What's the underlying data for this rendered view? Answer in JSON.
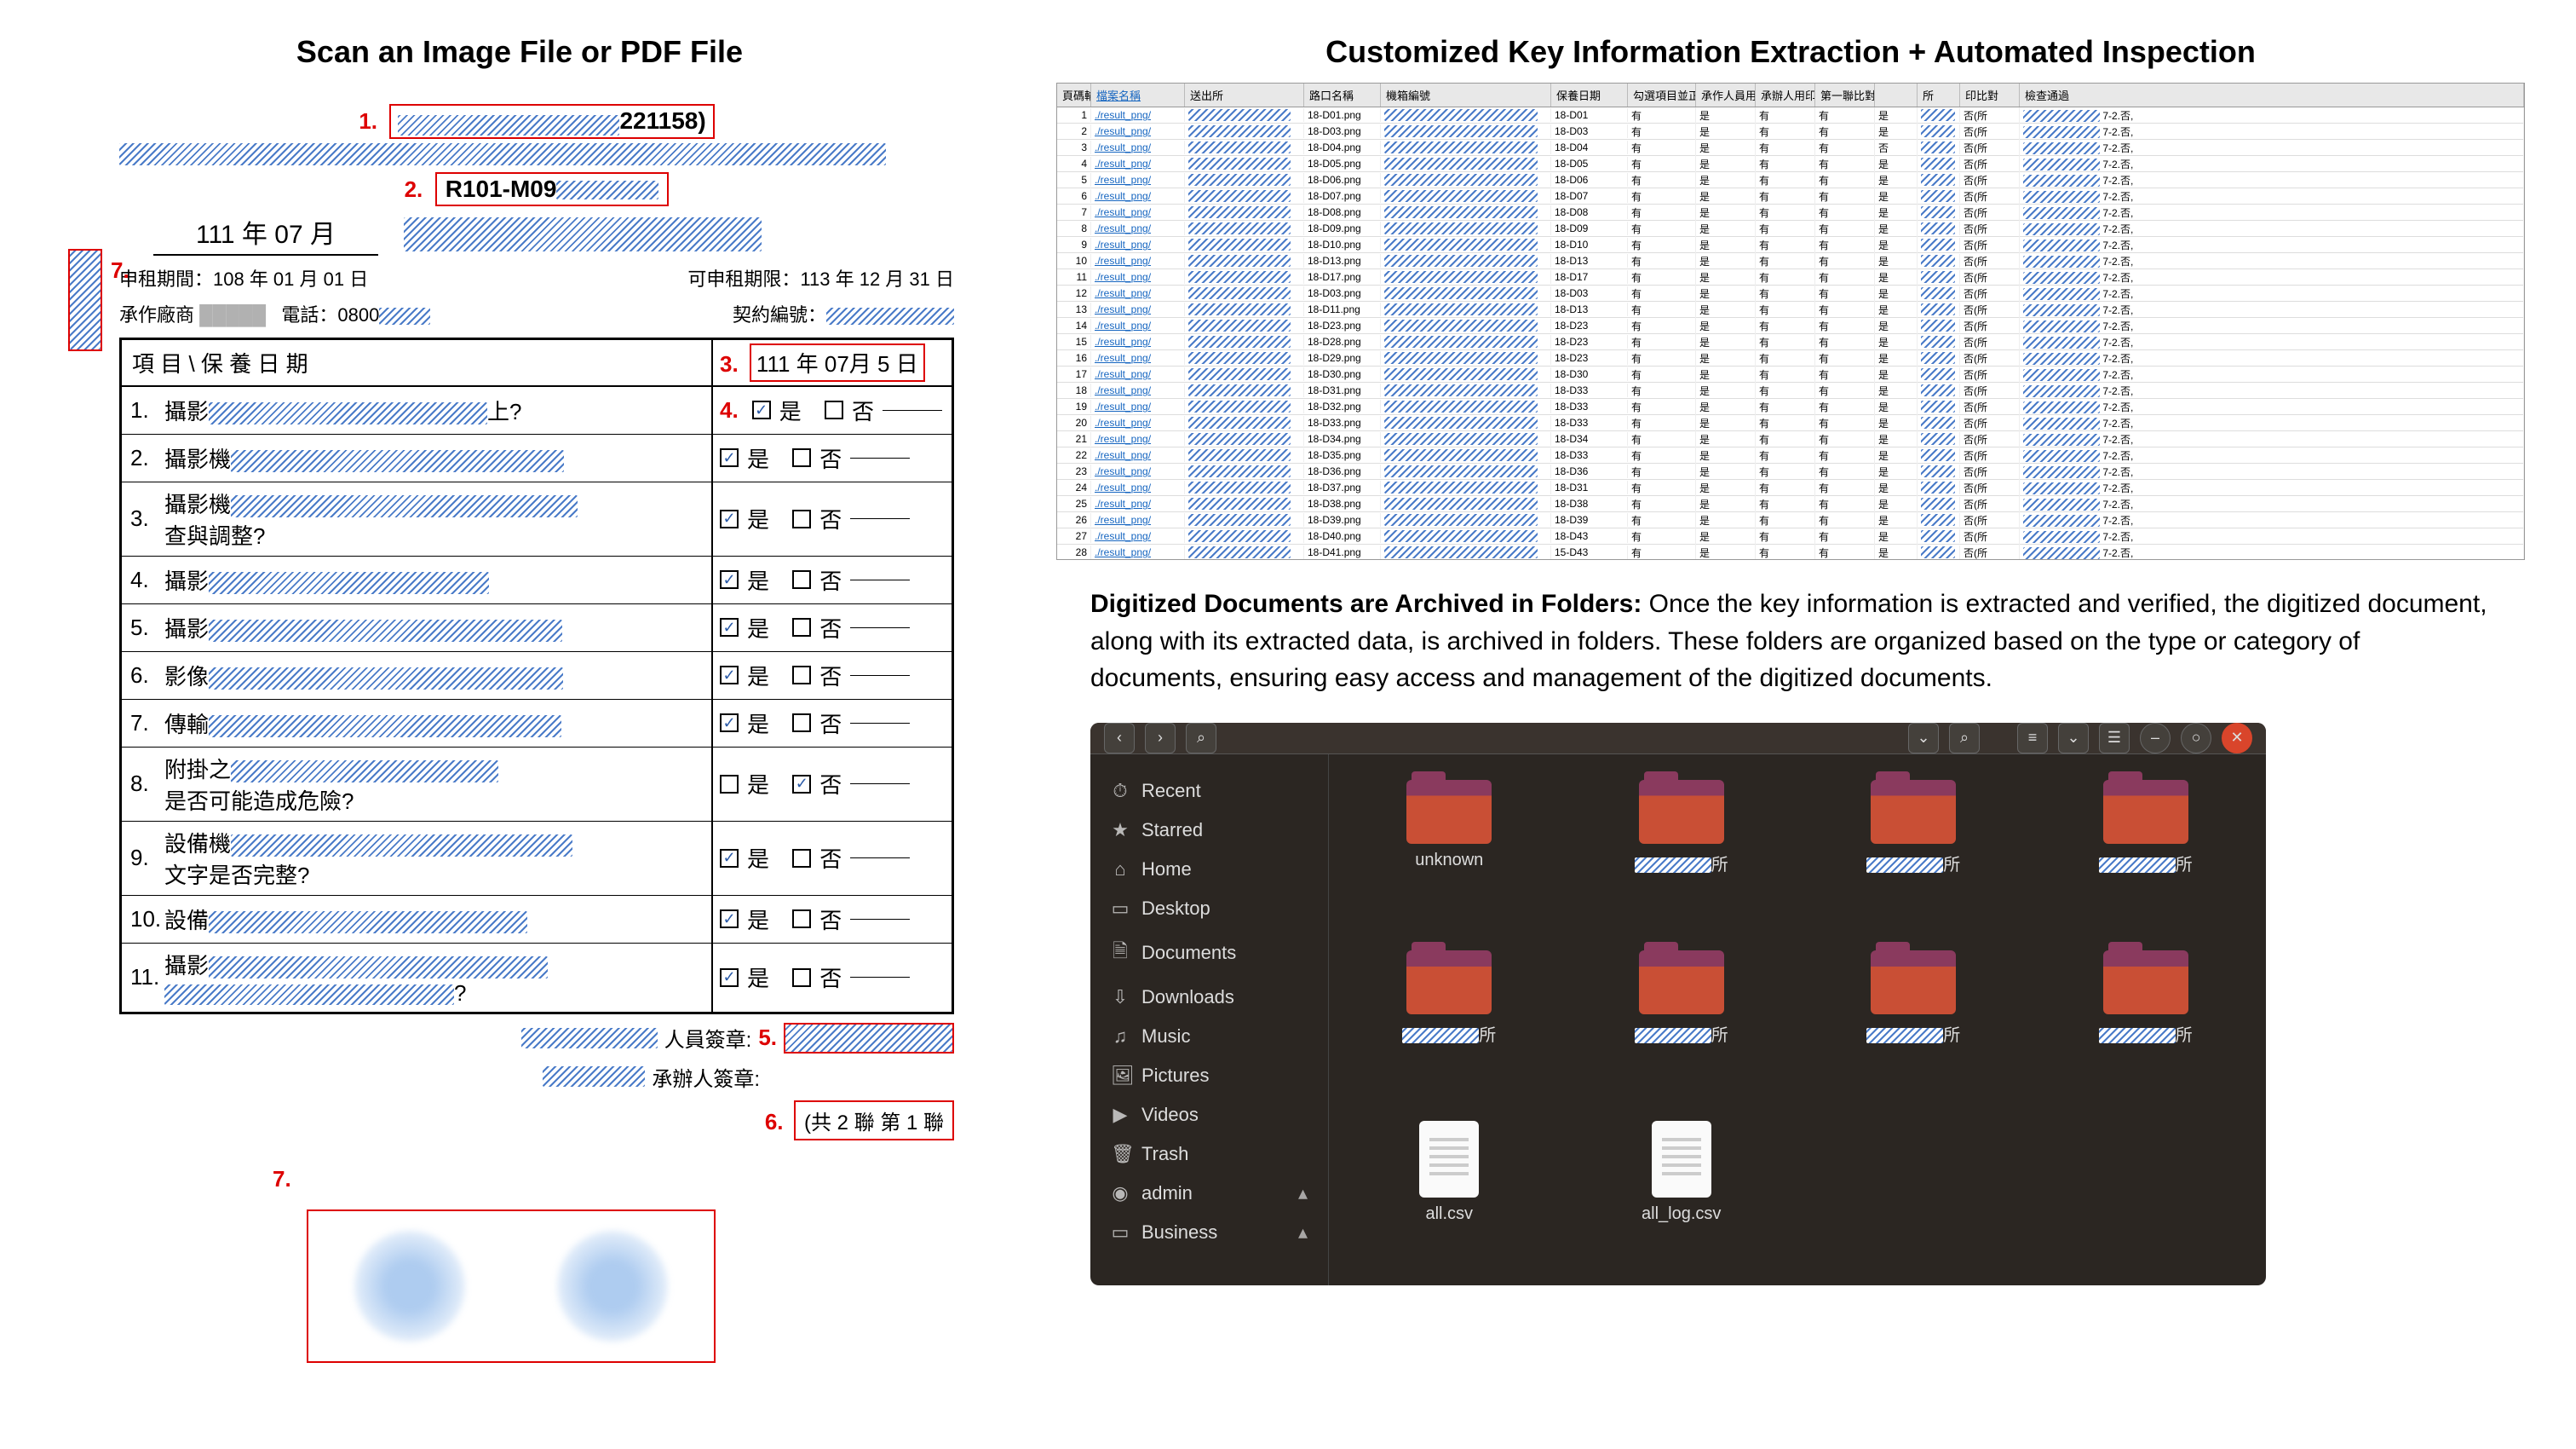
{
  "left": {
    "title": "Scan an Image File or PDF File",
    "markers": {
      "m1": "1.",
      "m2": "2.",
      "m3": "3.",
      "m4": "4.",
      "m5": "5.",
      "m6": "6.",
      "m7": "7.",
      "m7b": "7."
    },
    "doc_id_suffix": "221158)",
    "code": "R101-M09",
    "date_year_month": "111 年 07 月",
    "meta_left": "申租期間：108 年 01 月 01 日",
    "meta_right": "可申租期限：113 年 12 月 31 日",
    "meta_vendor": "承作廠商",
    "meta_tel": "電話：0800",
    "meta_contract": "契約編號：",
    "table_header_left": "項 目 \\ 保 養 日 期",
    "table_header_right": "111 年 07月 5 日",
    "questions": [
      {
        "n": "1.",
        "prefix": "攝影",
        "suffix": "上?",
        "yes": true,
        "no": false
      },
      {
        "n": "2.",
        "prefix": "攝影機",
        "suffix": "",
        "yes": true,
        "no": false
      },
      {
        "n": "3.",
        "prefix": "攝影機",
        "suffix": "",
        "line2": "查與調整?",
        "yes": true,
        "no": false
      },
      {
        "n": "4.",
        "prefix": "攝影",
        "suffix": "",
        "yes": true,
        "no": false
      },
      {
        "n": "5.",
        "prefix": "攝影",
        "suffix": "",
        "yes": true,
        "no": false
      },
      {
        "n": "6.",
        "prefix": "影像",
        "suffix": "",
        "yes": true,
        "no": false
      },
      {
        "n": "7.",
        "prefix": "傳輸",
        "suffix": "",
        "yes": true,
        "no": false
      },
      {
        "n": "8.",
        "prefix": "附掛之",
        "suffix": "",
        "line2": "是否可能造成危險?",
        "yes": false,
        "no": true
      },
      {
        "n": "9.",
        "prefix": "設備機",
        "suffix": "",
        "line2": "文字是否完整?",
        "yes": true,
        "no": false
      },
      {
        "n": "10.",
        "prefix": "設備",
        "suffix": "",
        "yes": true,
        "no": false
      },
      {
        "n": "11.",
        "prefix": "攝影",
        "suffix": "",
        "line2_redacted": true,
        "line2_suffix": "?",
        "yes": true,
        "no": false
      }
    ],
    "yes_label": "是",
    "no_label": "否",
    "sig1_label": "人員簽章:",
    "sig2_label": "承辦人簽章:",
    "copies": "(共 2 聯 第 1 聯"
  },
  "right": {
    "title": "Customized Key Information Extraction + Automated Inspection",
    "ss_headers": [
      "頁碼輸入順序",
      "檔案名稱",
      "送出所",
      "路口名稱",
      "機箱編號",
      "保養日期",
      "勾選項目並正確",
      "承作人員用印",
      "承辦人用印",
      "第一聯比對",
      "",
      "所",
      "印比對",
      "檢查通過"
    ],
    "ss_rows": [
      {
        "i": 1,
        "f": "./result_png/",
        "img": "18-D01.png",
        "code": "18-D01",
        "d": "有",
        "y1": "是",
        "y2": "有",
        "y3": "有",
        "y4": "是",
        "y5": "是",
        "y6": "否(所",
        "r": "7-2.否,"
      },
      {
        "i": 2,
        "f": "./result_png/",
        "img": "18-D03.png",
        "code": "18-D03",
        "d": "有",
        "y1": "是",
        "y2": "有",
        "y3": "有",
        "y4": "是",
        "y5": "是",
        "y6": "否(所",
        "r": "7-2.否,"
      },
      {
        "i": 3,
        "f": "./result_png/",
        "img": "18-D04.png",
        "code": "18-D04",
        "d": "有",
        "y1": "是",
        "y2": "有",
        "y3": "有",
        "y4": "否",
        "y5": "是",
        "y6": "否(所",
        "r": "7-2.否,"
      },
      {
        "i": 4,
        "f": "./result_png/",
        "img": "18-D05.png",
        "code": "18-D05",
        "d": "有",
        "y1": "是",
        "y2": "有",
        "y3": "有",
        "y4": "是",
        "y5": "是",
        "y6": "否(所",
        "r": "7-2.否,"
      },
      {
        "i": 5,
        "f": "./result_png/",
        "img": "18-D06.png",
        "code": "18-D06",
        "d": "有",
        "y1": "是",
        "y2": "有",
        "y3": "有",
        "y4": "是",
        "y5": "是",
        "y6": "否(所",
        "r": "7-2.否,"
      },
      {
        "i": 6,
        "f": "./result_png/",
        "img": "18-D07.png",
        "code": "18-D07",
        "d": "有",
        "y1": "是",
        "y2": "有",
        "y3": "有",
        "y4": "是",
        "y5": "是",
        "y6": "否(所",
        "r": "7-2.否,"
      },
      {
        "i": 7,
        "f": "./result_png/",
        "img": "18-D08.png",
        "code": "18-D08",
        "d": "有",
        "y1": "是",
        "y2": "有",
        "y3": "有",
        "y4": "是",
        "y5": "是",
        "y6": "否(所",
        "r": "7-2.否,"
      },
      {
        "i": 8,
        "f": "./result_png/",
        "img": "18-D09.png",
        "code": "18-D09",
        "d": "有",
        "y1": "是",
        "y2": "有",
        "y3": "有",
        "y4": "是",
        "y5": "是",
        "y6": "否(所",
        "r": "7-2.否,"
      },
      {
        "i": 9,
        "f": "./result_png/",
        "img": "18-D10.png",
        "code": "18-D10",
        "d": "有",
        "y1": "是",
        "y2": "有",
        "y3": "有",
        "y4": "是",
        "y5": "是",
        "y6": "否(所",
        "r": "7-2.否,"
      },
      {
        "i": 10,
        "f": "./result_png/",
        "img": "18-D13.png",
        "code": "18-D13",
        "d": "有",
        "y1": "是",
        "y2": "有",
        "y3": "有",
        "y4": "是",
        "y5": "是",
        "y6": "否(所",
        "r": "7-2.否,"
      },
      {
        "i": 11,
        "f": "./result_png/",
        "img": "18-D17.png",
        "code": "18-D17",
        "d": "有",
        "y1": "是",
        "y2": "有",
        "y3": "有",
        "y4": "是",
        "y5": "是",
        "y6": "否(所",
        "r": "7-2.否,"
      },
      {
        "i": 12,
        "f": "./result_png/",
        "img": "18-D03.png",
        "code": "18-D03",
        "d": "有",
        "y1": "是",
        "y2": "有",
        "y3": "有",
        "y4": "是",
        "y5": "是",
        "y6": "否(所",
        "r": "7-2.否,"
      },
      {
        "i": 13,
        "f": "./result_png/",
        "img": "18-D11.png",
        "code": "18-D13",
        "d": "有",
        "y1": "是",
        "y2": "有",
        "y3": "有",
        "y4": "是",
        "y5": "是",
        "y6": "否(所",
        "r": "7-2.否,"
      },
      {
        "i": 14,
        "f": "./result_png/",
        "img": "18-D23.png",
        "code": "18-D23",
        "d": "有",
        "y1": "是",
        "y2": "有",
        "y3": "有",
        "y4": "是",
        "y5": "是",
        "y6": "否(所",
        "r": "7-2.否,"
      },
      {
        "i": 15,
        "f": "./result_png/",
        "img": "18-D28.png",
        "code": "18-D23",
        "d": "有",
        "y1": "是",
        "y2": "有",
        "y3": "有",
        "y4": "是",
        "y5": "是",
        "y6": "否(所",
        "r": "7-2.否,"
      },
      {
        "i": 16,
        "f": "./result_png/",
        "img": "18-D29.png",
        "code": "18-D23",
        "d": "有",
        "y1": "是",
        "y2": "有",
        "y3": "有",
        "y4": "是",
        "y5": "是",
        "y6": "否(所",
        "r": "7-2.否,"
      },
      {
        "i": 17,
        "f": "./result_png/",
        "img": "18-D30.png",
        "code": "18-D30",
        "d": "有",
        "y1": "是",
        "y2": "有",
        "y3": "有",
        "y4": "是",
        "y5": "是",
        "y6": "否(所",
        "r": "7-2.否,"
      },
      {
        "i": 18,
        "f": "./result_png/",
        "img": "18-D31.png",
        "code": "18-D33",
        "d": "有",
        "y1": "是",
        "y2": "有",
        "y3": "有",
        "y4": "是",
        "y5": "是",
        "y6": "否(所",
        "r": "7-2.否,"
      },
      {
        "i": 19,
        "f": "./result_png/",
        "img": "18-D32.png",
        "code": "18-D33",
        "d": "有",
        "y1": "是",
        "y2": "有",
        "y3": "有",
        "y4": "是",
        "y5": "是",
        "y6": "否(所",
        "r": "7-2.否,"
      },
      {
        "i": 20,
        "f": "./result_png/",
        "img": "18-D33.png",
        "code": "18-D33",
        "d": "有",
        "y1": "是",
        "y2": "有",
        "y3": "有",
        "y4": "是",
        "y5": "是",
        "y6": "否(所",
        "r": "7-2.否,"
      },
      {
        "i": 21,
        "f": "./result_png/",
        "img": "18-D34.png",
        "code": "18-D34",
        "d": "有",
        "y1": "是",
        "y2": "有",
        "y3": "有",
        "y4": "是",
        "y5": "是",
        "y6": "否(所",
        "r": "7-2.否,"
      },
      {
        "i": 22,
        "f": "./result_png/",
        "img": "18-D35.png",
        "code": "18-D33",
        "d": "有",
        "y1": "是",
        "y2": "有",
        "y3": "有",
        "y4": "是",
        "y5": "是",
        "y6": "否(所",
        "r": "7-2.否,"
      },
      {
        "i": 23,
        "f": "./result_png/",
        "img": "18-D36.png",
        "code": "18-D36",
        "d": "有",
        "y1": "是",
        "y2": "有",
        "y3": "有",
        "y4": "是",
        "y5": "是",
        "y6": "否(所",
        "r": "7-2.否,"
      },
      {
        "i": 24,
        "f": "./result_png/",
        "img": "18-D37.png",
        "code": "18-D31",
        "d": "有",
        "y1": "是",
        "y2": "有",
        "y3": "有",
        "y4": "是",
        "y5": "是",
        "y6": "否(所",
        "r": "7-2.否,"
      },
      {
        "i": 25,
        "f": "./result_png/",
        "img": "18-D38.png",
        "code": "18-D38",
        "d": "有",
        "y1": "是",
        "y2": "有",
        "y3": "有",
        "y4": "是",
        "y5": "是",
        "y6": "否(所",
        "r": "7-2.否,"
      },
      {
        "i": 26,
        "f": "./result_png/",
        "img": "18-D39.png",
        "code": "18-D39",
        "d": "有",
        "y1": "是",
        "y2": "有",
        "y3": "有",
        "y4": "是",
        "y5": "是",
        "y6": "否(所",
        "r": "7-2.否,"
      },
      {
        "i": 27,
        "f": "./result_png/",
        "img": "18-D40.png",
        "code": "18-D43",
        "d": "有",
        "y1": "是",
        "y2": "有",
        "y3": "有",
        "y4": "是",
        "y5": "是",
        "y6": "否(所",
        "r": "7-2.否,"
      },
      {
        "i": 28,
        "f": "./result_png/",
        "img": "18-D41.png",
        "code": "15-D43",
        "d": "有",
        "y1": "是",
        "y2": "有",
        "y3": "有",
        "y4": "是",
        "y5": "是",
        "y6": "否(所",
        "r": "7-2.否,"
      }
    ],
    "desc_bold": "Digitized Documents are Archived in Folders:",
    "desc_text": " Once the key information is extracted and verified, the digitized document, along with its extracted data, is archived in folders. These folders are organized based on the type or category of documents, ensuring easy access and management of the digitized documents.",
    "fm": {
      "sidebar": [
        {
          "icon": "⏱",
          "label": "Recent"
        },
        {
          "icon": "★",
          "label": "Starred"
        },
        {
          "icon": "⌂",
          "label": "Home"
        },
        {
          "icon": "▭",
          "label": "Desktop"
        },
        {
          "icon": "🗎",
          "label": "Documents"
        },
        {
          "icon": "⇩",
          "label": "Downloads"
        },
        {
          "icon": "♫",
          "label": "Music"
        },
        {
          "icon": "🖼",
          "label": "Pictures"
        },
        {
          "icon": "▶",
          "label": "Videos"
        },
        {
          "icon": "🗑",
          "label": "Trash"
        },
        {
          "icon": "◉",
          "label": "admin",
          "arrow": "▴"
        },
        {
          "icon": "▭",
          "label": "Business",
          "arrow": "▴"
        }
      ],
      "folders": [
        {
          "label": "unknown",
          "redacted": false
        },
        {
          "label": "",
          "redacted": true,
          "suffix": "所"
        },
        {
          "label": "",
          "redacted": true,
          "suffix": "所"
        },
        {
          "label": "",
          "redacted": true,
          "suffix": "所"
        },
        {
          "label": "",
          "redacted": true,
          "suffix": "所"
        },
        {
          "label": "",
          "redacted": true,
          "suffix": "所"
        },
        {
          "label": "",
          "redacted": true,
          "suffix": "所"
        },
        {
          "label": "",
          "redacted": true,
          "suffix": "所"
        }
      ],
      "files": [
        {
          "label": "all.csv"
        },
        {
          "label": "all_log.csv"
        }
      ]
    }
  }
}
